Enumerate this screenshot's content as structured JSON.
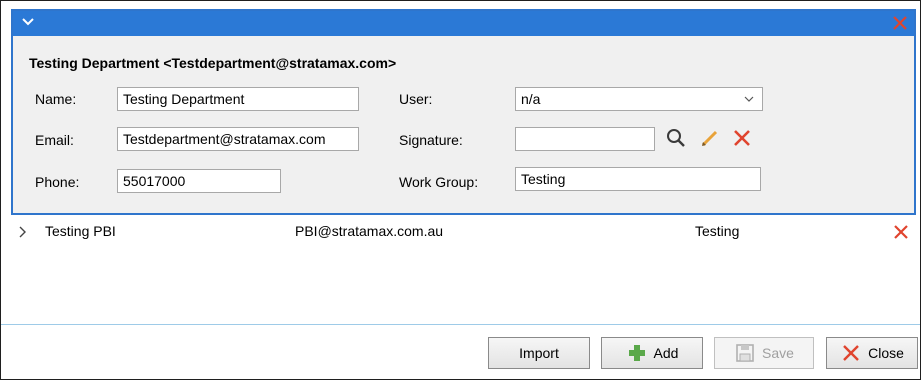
{
  "panel": {
    "header": "Testing Department  <Testdepartment@stratamax.com>"
  },
  "form": {
    "name_label": "Name:",
    "name_value": "Testing Department",
    "email_label": "Email:",
    "email_value": "Testdepartment@stratamax.com",
    "phone_label": "Phone:",
    "phone_value": "55017000",
    "user_label": "User:",
    "user_value": "n/a",
    "signature_label": "Signature:",
    "signature_value": "",
    "workgroup_label": "Work Group:",
    "workgroup_value": "Testing"
  },
  "list": {
    "rows": [
      {
        "name": "Testing PBI",
        "email": "PBI@stratamax.com.au",
        "group": "Testing"
      }
    ]
  },
  "buttons": {
    "import": "Import",
    "add": "Add",
    "save": "Save",
    "close": "Close"
  },
  "colors": {
    "accent": "#2b79d6",
    "delete_red": "#e0442e",
    "add_green": "#5aa84a",
    "edit_orange": "#e8a33a"
  },
  "icons": {
    "collapse": "chevron-down-icon",
    "panel_close": "close-icon",
    "search": "search-icon",
    "edit": "pencil-icon",
    "clear": "delete-icon",
    "expand_row": "chevron-right-icon",
    "add": "plus-icon",
    "save": "save-icon",
    "close": "close-icon"
  }
}
